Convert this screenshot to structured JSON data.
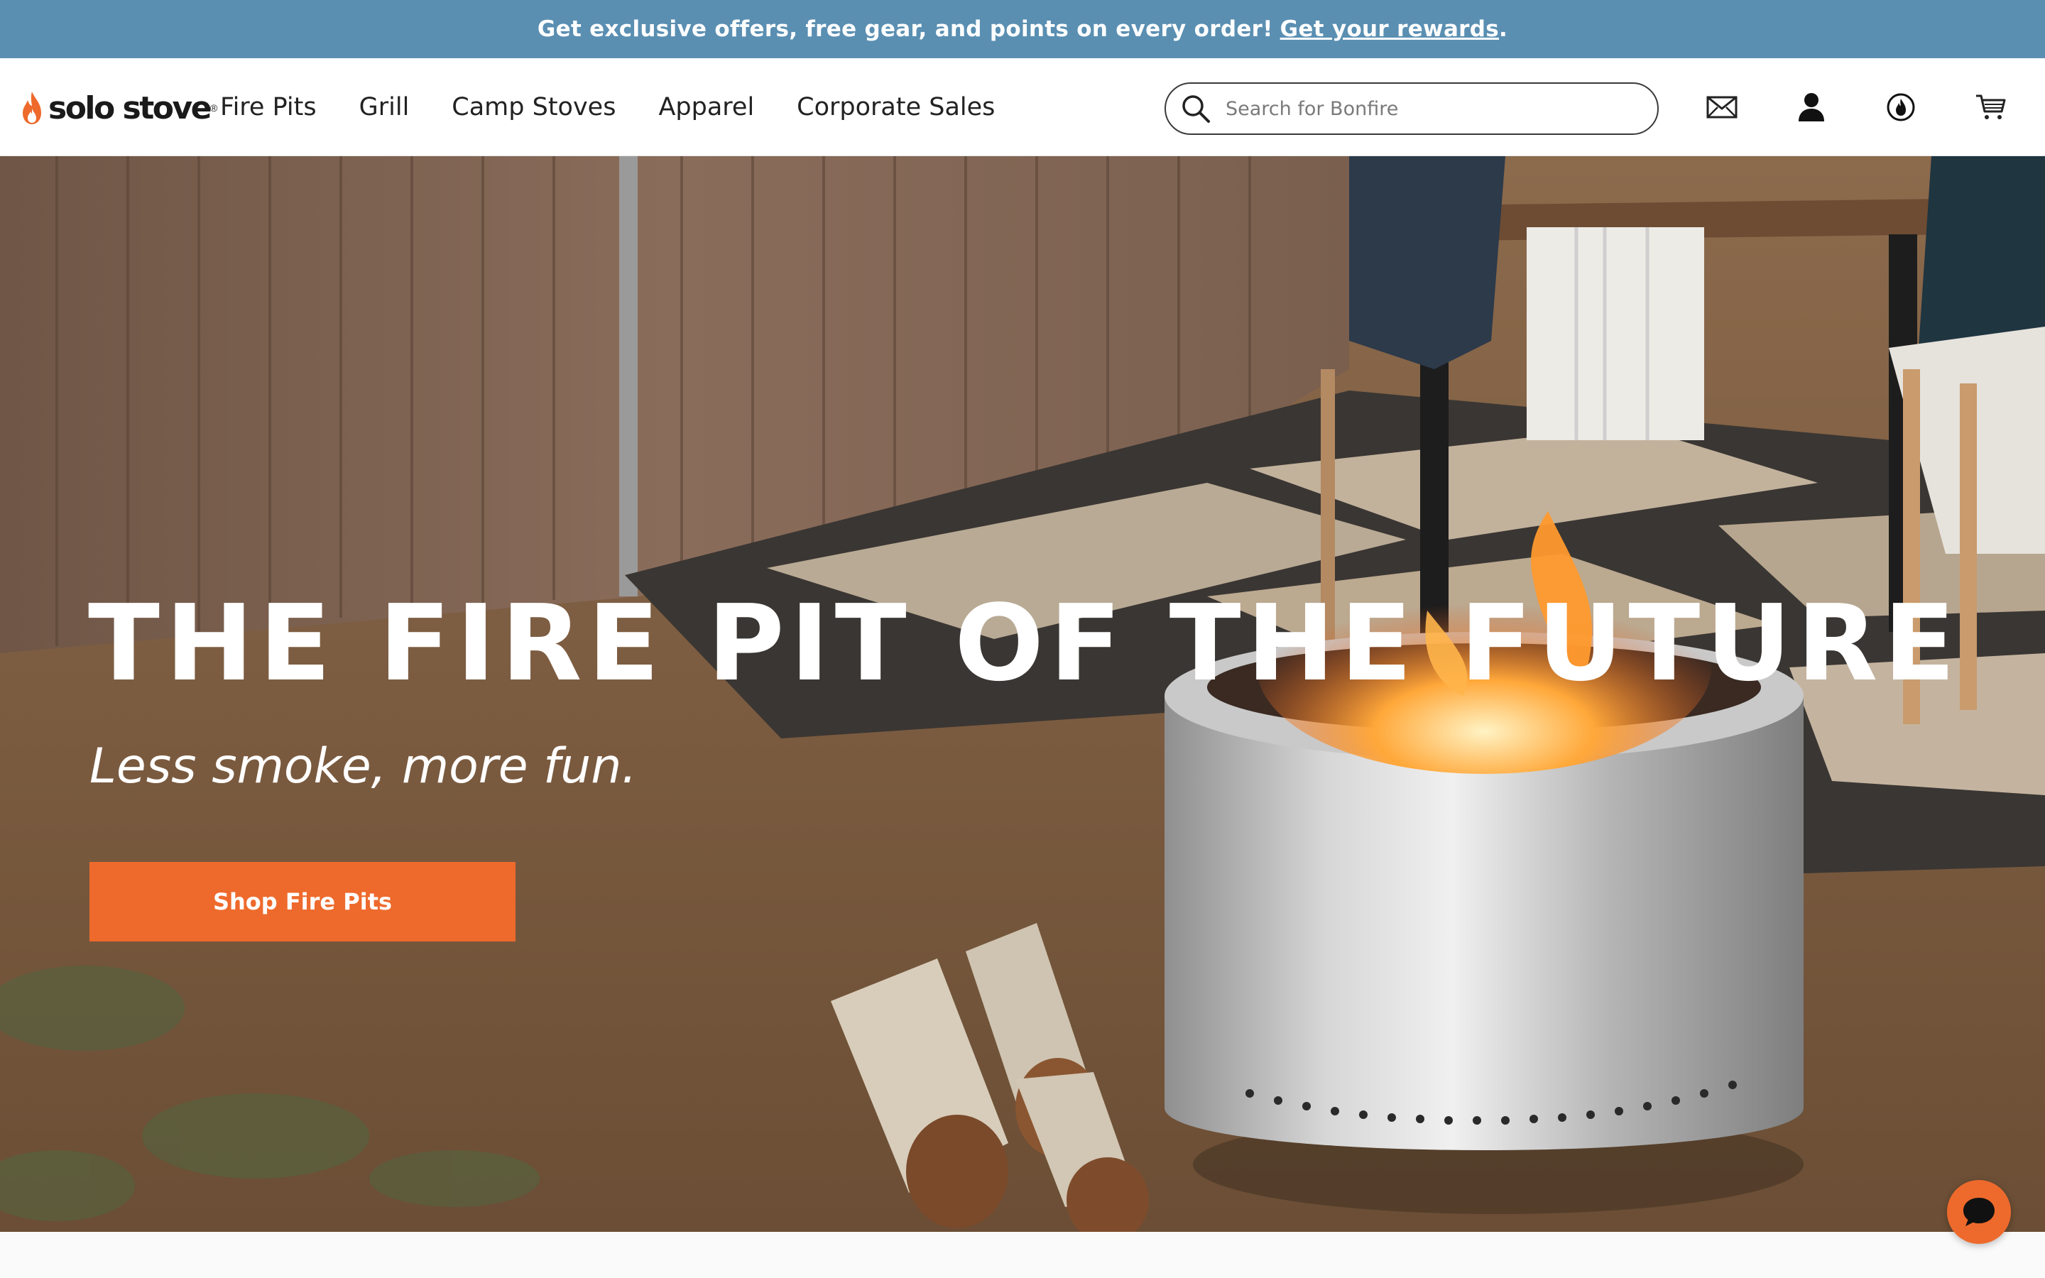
{
  "promo": {
    "text": "Get exclusive offers, free gear, and points on every order!",
    "link": "Get your rewards",
    "suffix": "."
  },
  "header": {
    "logo_text": "solo stove",
    "nav": [
      {
        "label": "Fire Pits"
      },
      {
        "label": "Grill"
      },
      {
        "label": "Camp Stoves"
      },
      {
        "label": "Apparel"
      },
      {
        "label": "Corporate Sales"
      }
    ],
    "search_placeholder": "Search for Bonfire",
    "icons": [
      "mail-icon",
      "account-icon",
      "rewards-flame-icon",
      "cart-icon"
    ]
  },
  "hero": {
    "title": "THE FIRE PIT OF THE FUTURE",
    "subtitle": "Less smoke, more fun.",
    "cta": "Shop Fire Pits"
  },
  "colors": {
    "promo_bg": "#5a8fb2",
    "accent": "#ee6a2c",
    "text": "#222222"
  }
}
